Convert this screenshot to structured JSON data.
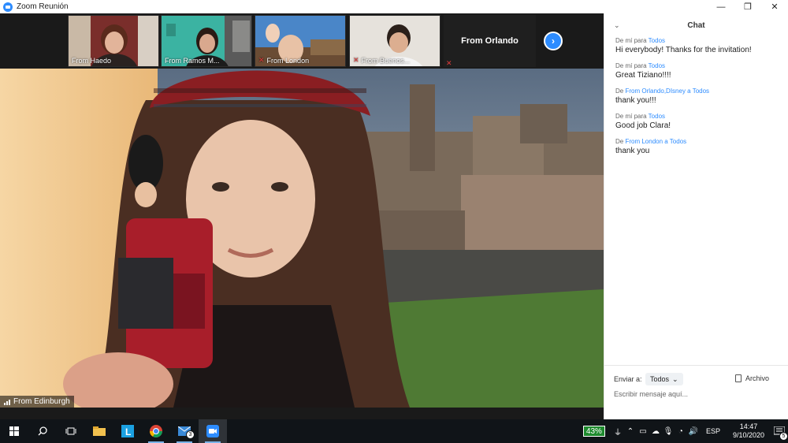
{
  "window": {
    "title": "Zoom Reunión",
    "controls": [
      "—",
      "❐",
      "✕"
    ]
  },
  "participants_strip": {
    "thumbnails": [
      {
        "label": "From Haedo",
        "muted": false
      },
      {
        "label": "From Ramos M...",
        "muted": false
      },
      {
        "label": "From London",
        "muted": true
      },
      {
        "label": "From Buenos...",
        "muted": true
      }
    ],
    "name_tile": "From Orlando",
    "next_icon": "chevron-right-icon"
  },
  "speaker": {
    "label": "From Edinburgh"
  },
  "chat": {
    "title": "Chat",
    "collapse_icon": "chevron-down-icon",
    "messages": [
      {
        "from": "De mí",
        "para": "para",
        "to": "Todos",
        "text": "Hi everybody! Thanks for the invitation!"
      },
      {
        "from": "De mí",
        "para": "para",
        "to": "Todos",
        "text": "Great Tiziano!!!!"
      },
      {
        "from": "De",
        "para": "",
        "to": "From Orlando,DIsney a Todos",
        "text": "thank you!!!"
      },
      {
        "from": "De mí",
        "para": "para",
        "to": "Todos",
        "text": "Good job Clara!"
      },
      {
        "from": "De",
        "para": "",
        "to": "From London a Todos",
        "text": "thank you"
      }
    ],
    "send_to_label": "Enviar a:",
    "send_to_value": "Todos",
    "file_label": "Archivo",
    "input_placeholder": "Escribir mensaje aquí..."
  },
  "taskbar": {
    "battery": "43%",
    "language": "ESP",
    "time": "14:47",
    "date": "9/10/2020",
    "mail_badge": "3",
    "notification_badge": "5"
  },
  "colors": {
    "zoom_blue": "#2d8cff",
    "taskbar_bg": "#101418",
    "battery_green": "#1e8a2e"
  }
}
